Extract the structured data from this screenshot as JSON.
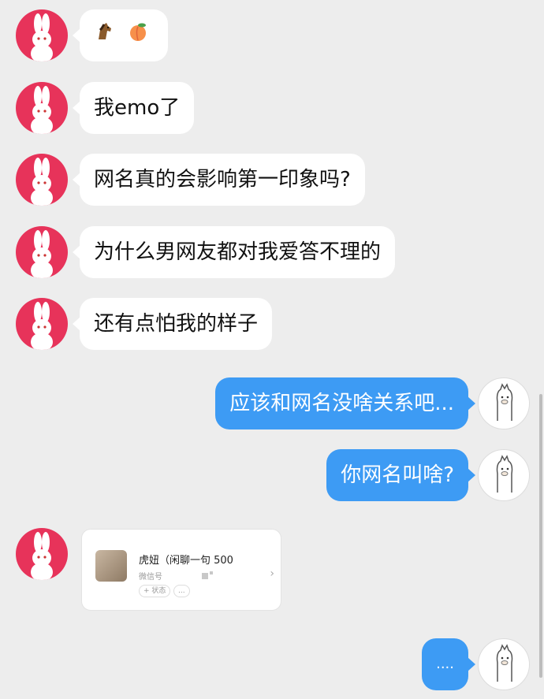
{
  "messages": [
    {
      "side": "in",
      "emoji": [
        "horse-icon",
        "peach-icon"
      ],
      "text": ""
    },
    {
      "side": "in",
      "text": "我emo了"
    },
    {
      "side": "in",
      "text": "网名真的会影响第一印象吗?"
    },
    {
      "side": "in",
      "text": "为什么男网友都对我爱答不理的"
    },
    {
      "side": "in",
      "text": "还有点怕我的样子"
    },
    {
      "side": "out",
      "text": "应该和网名没啥关系吧..."
    },
    {
      "side": "out",
      "text": "你网名叫啥?"
    },
    {
      "side": "out",
      "text": "...."
    }
  ],
  "contact_card": {
    "name": "虎妞（闲聊一句 500",
    "subtitle": "微信号",
    "status": "+ 状态",
    "more": "...",
    "chevron": "›"
  },
  "colors": {
    "background": "#ededed",
    "incoming_bubble": "#ffffff",
    "outgoing_bubble": "#3d9bf4",
    "avatar_pink": "#e7335a"
  },
  "avatars": {
    "left": "rabbit-avatar",
    "right": "alpaca-avatar"
  }
}
